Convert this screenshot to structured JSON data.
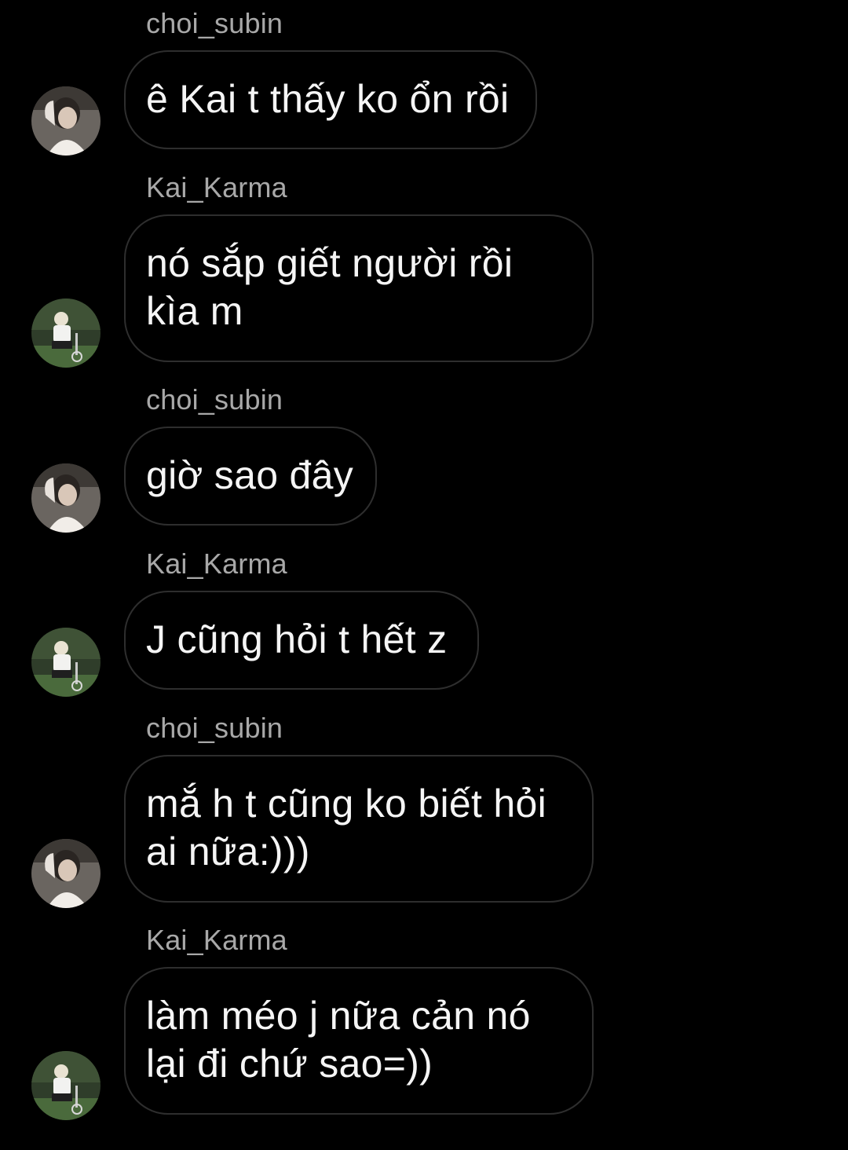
{
  "thread": {
    "messages": [
      {
        "sender": "choi_subin",
        "text": "ê Kai t thấy ko ổn rồi",
        "avatar": "avatar-choi-subin"
      },
      {
        "sender": "Kai_Karma",
        "text": "nó sắp giết người rồi\nkìa m",
        "avatar": "avatar-kai-karma"
      },
      {
        "sender": "choi_subin",
        "text": "giờ sao đây",
        "avatar": "avatar-choi-subin"
      },
      {
        "sender": "Kai_Karma",
        "text": "J cũng hỏi t hết z",
        "avatar": "avatar-kai-karma"
      },
      {
        "sender": "choi_subin",
        "text": "mắ h t cũng ko biết hỏi\nai nữa:)))",
        "avatar": "avatar-choi-subin"
      },
      {
        "sender": "Kai_Karma",
        "text": "làm méo j nữa cản nó\nlại đi chứ sao=))",
        "avatar": "avatar-kai-karma"
      }
    ]
  },
  "colors": {
    "background": "#000000",
    "bubble_border": "#2e2e2e",
    "sender_text": "#a8a8a8",
    "message_text": "#f5f5f5"
  }
}
